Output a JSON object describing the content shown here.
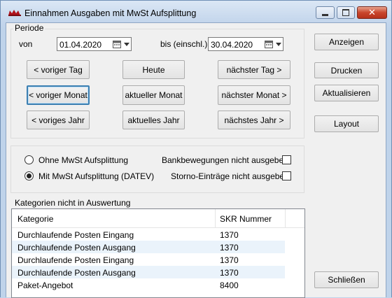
{
  "window": {
    "title": "Einnahmen Ausgaben mit MwSt Aufsplittung"
  },
  "periode": {
    "label": "Periode",
    "von_label": "von",
    "von_value": "01.04.2020",
    "bis_label": "bis (einschl.)",
    "bis_value": "30.04.2020",
    "buttons": {
      "voriger_tag": "< voriger Tag",
      "heute": "Heute",
      "naechster_tag": "nächster Tag >",
      "voriger_monat": "< voriger Monat",
      "aktueller_monat": "aktueller Monat",
      "naechster_monat": "nächster Monat >",
      "voriges_jahr": "< voriges Jahr",
      "aktuelles_jahr": "aktuelles Jahr",
      "naechstes_jahr": "nächstes Jahr >"
    }
  },
  "options": {
    "ohne_mwst": "Ohne MwSt Aufsplittung",
    "mit_mwst": "Mit MwSt Aufsplittung (DATEV)",
    "bankbewegungen": "Bankbewegungen nicht ausgeben",
    "storno": "Storno-Einträge nicht ausgeben"
  },
  "kategorien": {
    "label": "Kategorien nicht in Auswertung",
    "columns": [
      "Kategorie",
      "SKR Nummer"
    ],
    "rows": [
      {
        "kategorie": "Durchlaufende Posten Eingang",
        "nummer": "1370"
      },
      {
        "kategorie": "Durchlaufende Posten Ausgang",
        "nummer": "1370"
      },
      {
        "kategorie": "Durchlaufende Posten Eingang",
        "nummer": "1370"
      },
      {
        "kategorie": "Durchlaufende Posten Ausgang",
        "nummer": "1370"
      },
      {
        "kategorie": "Paket-Angebot",
        "nummer": "8400"
      }
    ]
  },
  "side_buttons": {
    "anzeigen": "Anzeigen",
    "drucken": "Drucken",
    "aktualisieren": "Aktualisieren",
    "layout": "Layout",
    "schliessen": "Schließen"
  }
}
